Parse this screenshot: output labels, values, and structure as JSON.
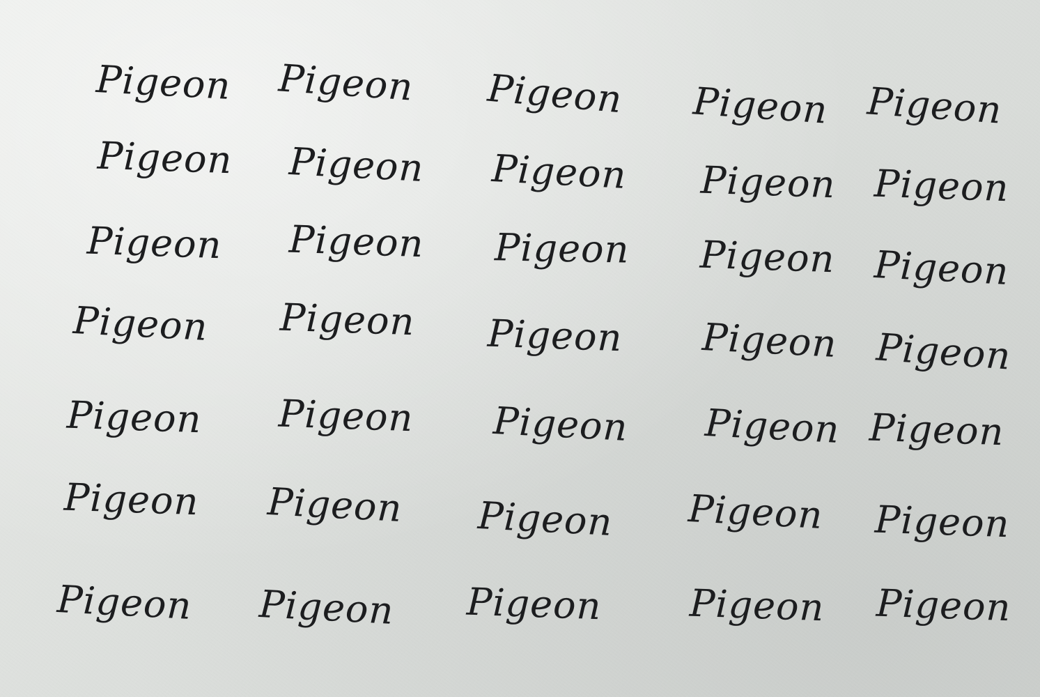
{
  "sheet": {
    "paper_color": "#dfe1de",
    "ink_color": "#1c1d1f",
    "rows": [
      [
        "Pigeon",
        "Pigeon",
        "Pigeon",
        "Pigeon",
        "Pigeon"
      ],
      [
        "Pigeon",
        "Pigeon",
        "Pigeon",
        "Pigeon",
        "Pigeon"
      ],
      [
        "Pigeon",
        "Pigeon",
        "Pigeon",
        "Pigeon",
        "Pigeon"
      ],
      [
        "Pigeon",
        "Pigeon",
        "Pigeon",
        "Pigeon",
        "Pigeon"
      ],
      [
        "Pigeon",
        "Pigeon",
        "Pigeon",
        "Pigeon",
        "Pigeon"
      ],
      [
        "Pigeon",
        "Pigeon",
        "Pigeon",
        "Pigeon",
        "Pigeon"
      ],
      [
        "Pigeon",
        "Pigeon",
        "Pigeon",
        "Pigeon",
        "Pigeon"
      ]
    ]
  }
}
